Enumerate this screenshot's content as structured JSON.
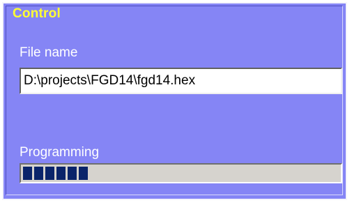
{
  "group": {
    "title": "Control"
  },
  "file": {
    "label": "File name",
    "value": "D:\\projects\\FGD14\\fgd14.hex"
  },
  "programming": {
    "label": "Programming",
    "progress_fraction": 0.2
  },
  "colors": {
    "panel_background": "#8585f5",
    "title": "#ffff33",
    "label": "#ffffff",
    "progress_track": "#d6d3ce",
    "progress_fill": "#0a246a"
  }
}
